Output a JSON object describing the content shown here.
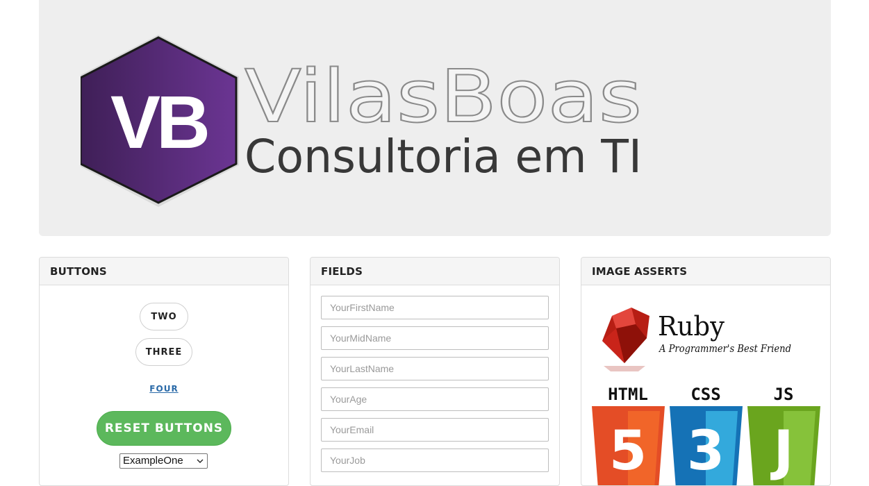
{
  "banner": {
    "logo_initials": "VB",
    "logo_title": "VilasBoas",
    "logo_subtitle": "Consultoria em TI"
  },
  "buttons_panel": {
    "title": "BUTTONS",
    "two_label": "TWO",
    "three_label": "THREE",
    "four_link": "FOUR",
    "reset_label": "RESET BUTTONS",
    "select_value": "ExampleOne"
  },
  "fields_panel": {
    "title": "FIELDS",
    "fields": [
      {
        "placeholder": "YourFirstName"
      },
      {
        "placeholder": "YourMidName"
      },
      {
        "placeholder": "YourLastName"
      },
      {
        "placeholder": "YourAge"
      },
      {
        "placeholder": "YourEmail"
      },
      {
        "placeholder": "YourJob"
      }
    ]
  },
  "images_panel": {
    "title": "IMAGE ASSERTS",
    "ruby_title": "Ruby",
    "ruby_tagline": "A Programmer's Best Friend",
    "tiles": [
      {
        "label": "HTML",
        "digit": "5"
      },
      {
        "label": "CSS",
        "digit": "3"
      },
      {
        "label": "JS",
        "digit": "J"
      }
    ]
  },
  "colors": {
    "logo_purple": "#5a2d7e",
    "reset_green": "#5cb85c",
    "html_orange": "#e44d26",
    "css_blue": "#1572b6",
    "js_green": "#6aa51e",
    "ruby_red": "#b71e14"
  }
}
